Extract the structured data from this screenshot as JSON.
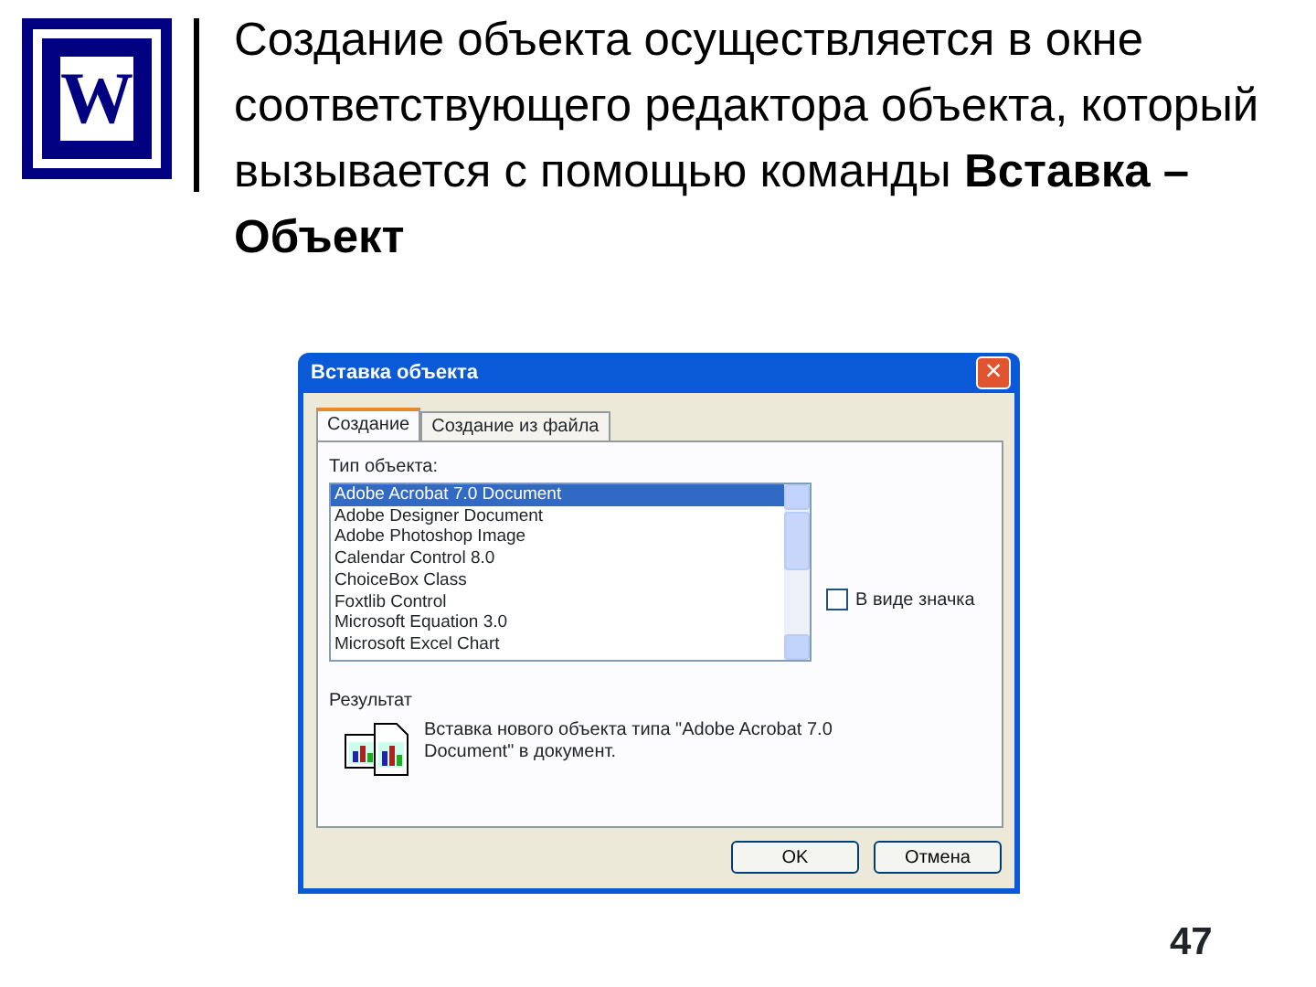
{
  "logo": {
    "letter": "W"
  },
  "heading": "Создание объекта осуществляется в окне соответствующего редактора объекта, который вызывается с помощью команды **Вставка – Объект**",
  "dialog": {
    "title": "Вставка объекта",
    "close": "×",
    "tabs": [
      {
        "label": "Создание",
        "selected": true
      },
      {
        "label": "Создание из файла",
        "selected": false
      }
    ],
    "list_label": "Тип объекта:",
    "items": [
      {
        "label": "Adobe Acrobat 7.0 Document",
        "selected": true
      },
      {
        "label": "Adobe Designer Document",
        "selected": false
      },
      {
        "label": "Adobe Photoshop Image",
        "selected": false
      },
      {
        "label": "Calendar Control 8.0",
        "selected": false
      },
      {
        "label": "ChoiceBox Class",
        "selected": false
      },
      {
        "label": "Foxtlib Control",
        "selected": false
      },
      {
        "label": "Microsoft Equation 3.0",
        "selected": false
      },
      {
        "label": "Microsoft Excel Chart",
        "selected": false
      }
    ],
    "as_icon": {
      "label": "В виде значка",
      "checked": false
    },
    "result_label": "Результат",
    "result_text": "Вставка нового объекта типа \"Adobe Acrobat 7.0 Document\" в документ.",
    "buttons": [
      "OK",
      "Отмена"
    ]
  },
  "page_number": "47"
}
